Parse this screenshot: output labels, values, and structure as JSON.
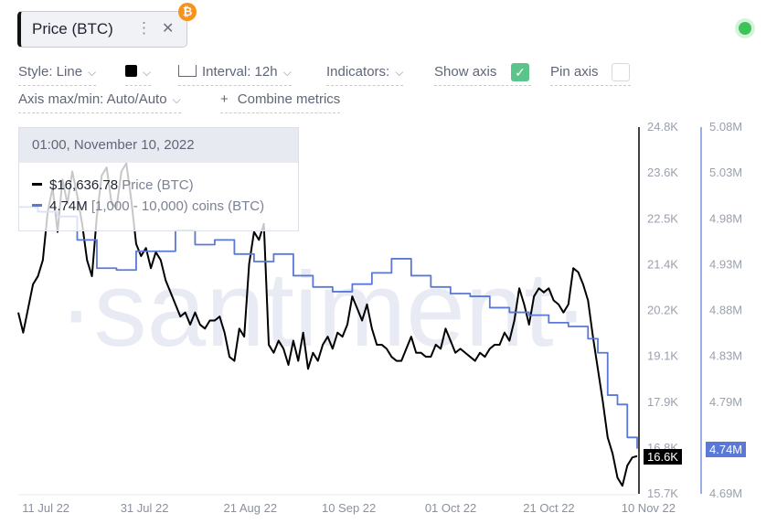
{
  "metric_chip": {
    "label": "Price (BTC)",
    "menu_icon": "vertical-dots-icon",
    "close_icon": "close-icon",
    "badge_icon": "bitcoin-icon",
    "badge_glyph": "₿",
    "line_color": "#000000"
  },
  "status": {
    "icon": "online-status-icon",
    "color": "#3ec35a"
  },
  "toolbar": {
    "style_label": "Style: Line",
    "color_swatch": "#000000",
    "interval_label": "Interval: 12h",
    "indicators_label": "Indicators:",
    "show_axis_label": "Show axis",
    "show_axis_checked": true,
    "pin_axis_label": "Pin axis",
    "pin_axis_checked": false,
    "axis_maxmin_label": "Axis max/min: Auto/Auto",
    "combine_label": "Combine metrics",
    "combine_glyph": "+",
    "chevron_glyph": "⌄",
    "check_glyph": "✓"
  },
  "tooltip": {
    "date": "01:00, November 10, 2022",
    "rows": [
      {
        "value": "$16,636.78",
        "name": "Price (BTC)",
        "color": "#000000"
      },
      {
        "value": "4.74M",
        "name": "[1,000 - 10,000) coins (BTC)",
        "color": "#5a78d6"
      }
    ]
  },
  "watermark": "·santiment·",
  "chart_data": {
    "type": "line",
    "title": "",
    "xlabel": "",
    "x_ticks": [
      "11 Jul 22",
      "31 Jul 22",
      "21 Aug 22",
      "10 Sep 22",
      "01 Oct 22",
      "21 Oct 22",
      "10 Nov 22"
    ],
    "x_range": [
      "2022-07-05",
      "2022-11-10"
    ],
    "grid": false,
    "legend": "tooltip top-left",
    "axes": [
      {
        "series": "Price (BTC)",
        "color": "#000000",
        "ticks": [
          "24.8K",
          "23.6K",
          "22.5K",
          "21.4K",
          "20.2K",
          "19.1K",
          "17.9K",
          "16.8K",
          "15.7K"
        ],
        "ylim": [
          15700,
          24800
        ],
        "current_label": "16.6K",
        "current_label_bg": "#000000"
      },
      {
        "series": "[1,000 - 10,000) coins (BTC)",
        "color": "#5a78d6",
        "ticks": [
          "5.08M",
          "5.03M",
          "4.98M",
          "4.93M",
          "4.88M",
          "4.83M",
          "4.79M",
          "4.74M",
          "4.69M"
        ],
        "ylim": [
          4.69,
          5.08
        ],
        "current_label": "4.74M",
        "current_label_bg": "#5a78d6"
      }
    ],
    "series": [
      {
        "name": "Price (BTC)",
        "axis": 0,
        "unit": "USD",
        "x_days": [
          0,
          1,
          2,
          3,
          4,
          5,
          6,
          7,
          8,
          9,
          10,
          11,
          12,
          13,
          14,
          15,
          16,
          17,
          18,
          19,
          20,
          21,
          22,
          23,
          24,
          25,
          26,
          27,
          28,
          29,
          30,
          31,
          32,
          33,
          34,
          35,
          36,
          37,
          38,
          39,
          40,
          41,
          42,
          43,
          44,
          45,
          46,
          47,
          48,
          49,
          50,
          51,
          52,
          53,
          54,
          55,
          56,
          57,
          58,
          59,
          60,
          61,
          62,
          63,
          64,
          65,
          66,
          67,
          68,
          69,
          70,
          71,
          72,
          73,
          74,
          75,
          76,
          77,
          78,
          79,
          80,
          81,
          82,
          83,
          84,
          85,
          86,
          87,
          88,
          89,
          90,
          91,
          92,
          93,
          94,
          95,
          96,
          97,
          98,
          99,
          100,
          101,
          102,
          103,
          104,
          105,
          106,
          107,
          108,
          109,
          110,
          111,
          112,
          113,
          114,
          115,
          116,
          117,
          118,
          119,
          120,
          121,
          122,
          123,
          124,
          125,
          126
        ],
        "values": [
          20200,
          19700,
          20300,
          20900,
          21100,
          21500,
          22700,
          23300,
          22200,
          23500,
          22900,
          23700,
          23100,
          22400,
          21500,
          21100,
          22600,
          23600,
          23800,
          22900,
          22800,
          23700,
          23900,
          23000,
          21900,
          21600,
          21800,
          21300,
          21700,
          21500,
          21000,
          20700,
          20400,
          20100,
          20200,
          19900,
          20200,
          19900,
          19800,
          20000,
          20000,
          20100,
          19700,
          19100,
          19000,
          19800,
          19600,
          21400,
          22200,
          22000,
          22400,
          19400,
          19200,
          19500,
          19300,
          18900,
          19500,
          19000,
          19700,
          18800,
          19200,
          19000,
          19400,
          19600,
          19300,
          19700,
          19600,
          19900,
          20600,
          20300,
          20000,
          20400,
          19800,
          19400,
          19400,
          19300,
          19100,
          19000,
          19000,
          19300,
          19600,
          19200,
          19200,
          19100,
          19100,
          19400,
          19300,
          19800,
          19500,
          19200,
          19300,
          19200,
          19100,
          19000,
          19200,
          19100,
          19300,
          19400,
          19400,
          19700,
          19500,
          20000,
          20800,
          20400,
          19900,
          20600,
          20800,
          20700,
          20800,
          20500,
          20400,
          20200,
          20400,
          21300,
          21200,
          20900,
          20500,
          19600,
          18800,
          18000,
          17100,
          16700,
          16100,
          15900,
          16400,
          16600,
          16637
        ]
      },
      {
        "name": "[1,000 - 10,000) coins (BTC)",
        "axis": 1,
        "unit": "millions",
        "x_days": [
          0,
          4,
          8,
          12,
          16,
          20,
          24,
          28,
          32,
          36,
          40,
          44,
          48,
          52,
          56,
          60,
          64,
          68,
          72,
          76,
          80,
          84,
          88,
          92,
          96,
          100,
          104,
          108,
          112,
          116,
          118,
          120,
          122,
          124,
          126
        ],
        "values": [
          4.995,
          4.99,
          4.985,
          4.96,
          4.93,
          4.928,
          4.948,
          4.948,
          4.97,
          4.955,
          4.96,
          4.945,
          4.937,
          4.945,
          4.922,
          4.91,
          4.905,
          4.913,
          4.925,
          4.94,
          4.922,
          4.91,
          4.903,
          4.9,
          4.888,
          4.883,
          4.88,
          4.872,
          4.868,
          4.855,
          4.84,
          4.795,
          4.785,
          4.75,
          4.738
        ]
      }
    ]
  }
}
